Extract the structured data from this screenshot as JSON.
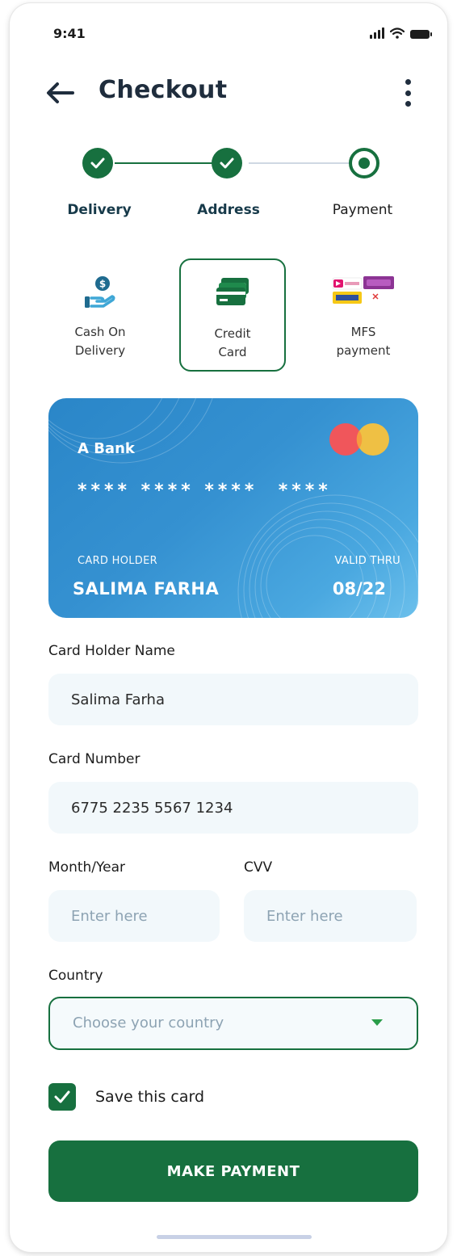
{
  "status_bar": {
    "time": "9:41"
  },
  "header": {
    "title": "Checkout"
  },
  "stepper": {
    "steps": [
      {
        "label": "Delivery",
        "state": "done"
      },
      {
        "label": "Address",
        "state": "done"
      },
      {
        "label": "Payment",
        "state": "current"
      }
    ]
  },
  "payment_methods": [
    {
      "line1": "Cash On",
      "line2": "Delivery",
      "icon": "cash-hand-icon",
      "selected": false
    },
    {
      "line1": "Credit",
      "line2": "Card",
      "icon": "credit-card-icon",
      "selected": true
    },
    {
      "line1": "MFS",
      "line2": "payment",
      "icon": "mfs-logos-icon",
      "selected": false
    }
  ],
  "card": {
    "bank": "A Bank",
    "masked_number": "**** **** ****  ****",
    "holder_caption": "CARD HOLDER",
    "holder_name": "SALIMA FARHA",
    "valid_caption": "VALID THRU",
    "valid_date": "08/22"
  },
  "form": {
    "holder_label": "Card Holder Name",
    "holder_value": "Salima Farha",
    "number_label": "Card Number",
    "number_value": "6775 2235 5567 1234",
    "month_label": "Month/Year",
    "month_placeholder": "Enter here",
    "cvv_label": "CVV",
    "cvv_placeholder": "Enter here",
    "country_label": "Country",
    "country_placeholder": "Choose your country",
    "save_label": "Save this card",
    "save_checked": true
  },
  "actions": {
    "pay_label": "MAKE PAYMENT"
  },
  "colors": {
    "primary": "#17703f",
    "card_blue": "#2a86c8",
    "field_bg": "#f2f8fb"
  }
}
